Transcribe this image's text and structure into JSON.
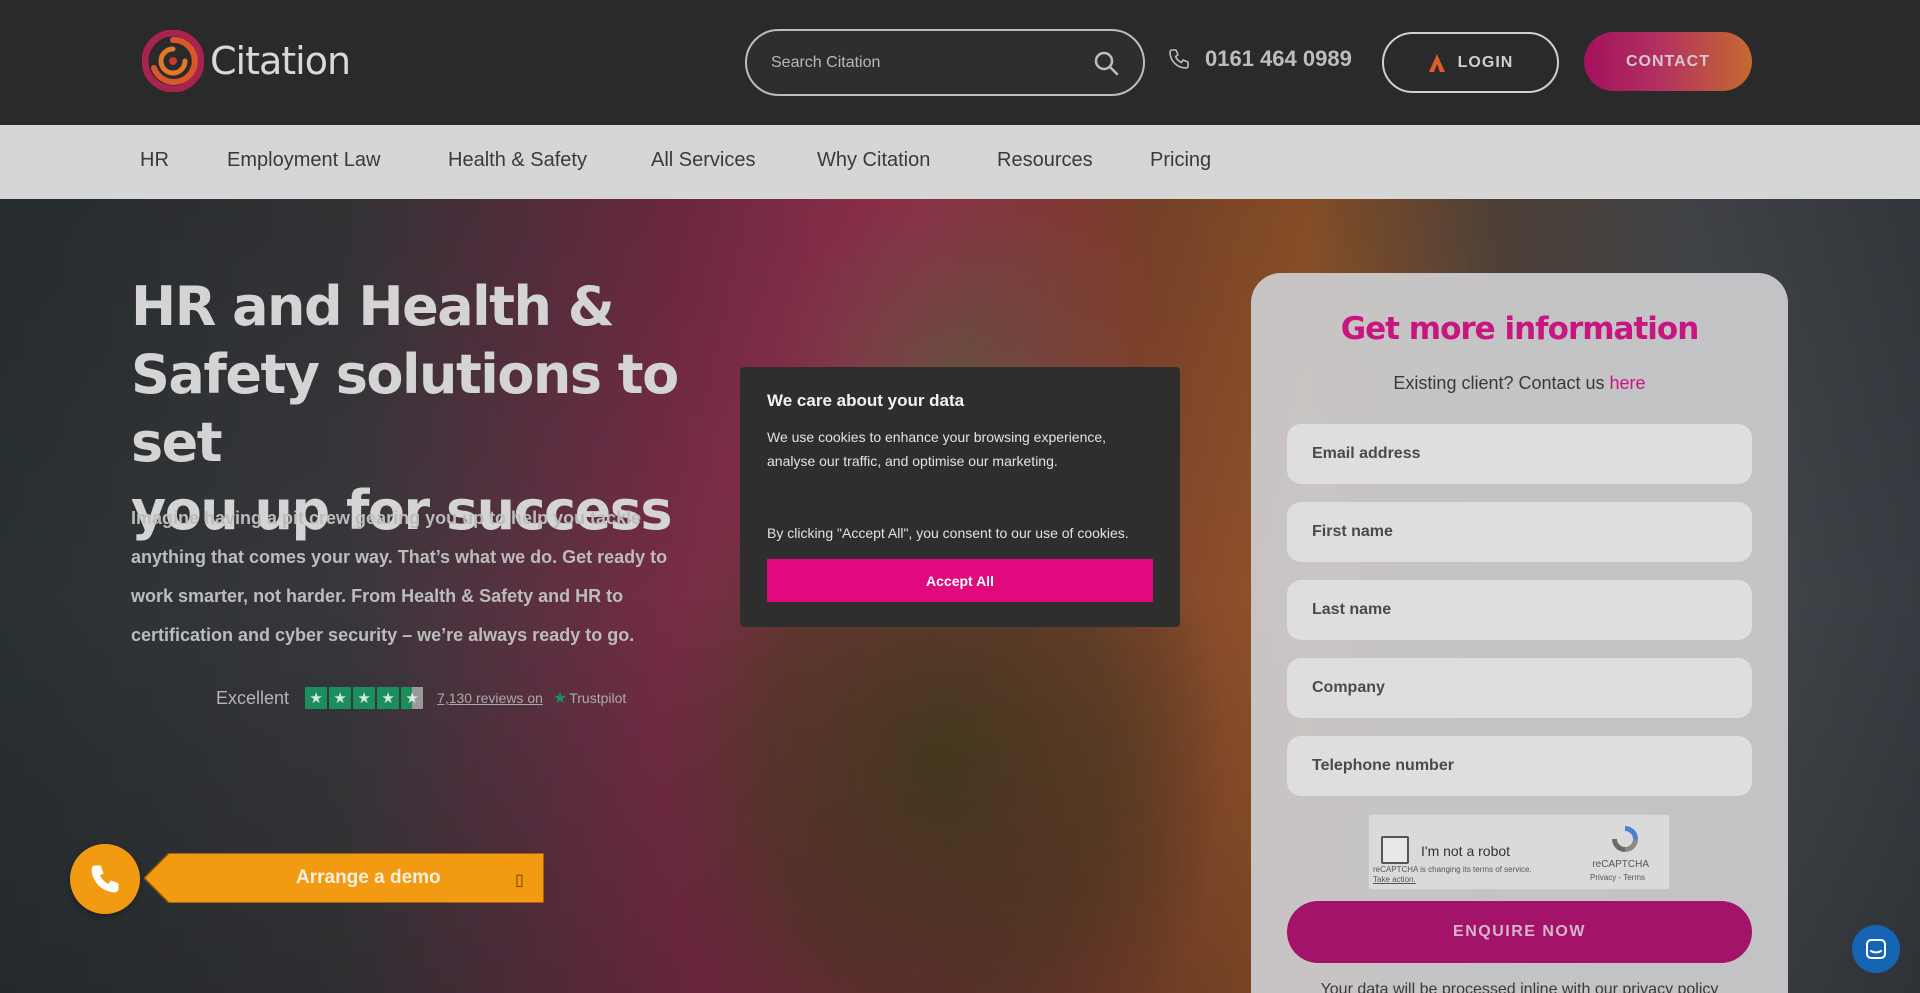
{
  "brand": {
    "name": "Citation"
  },
  "header": {
    "search_placeholder": "Search Citation",
    "phone": "0161 464 0989",
    "login_label": "LOGIN",
    "contact_label": "CONTACT"
  },
  "nav": {
    "items": [
      {
        "label": "HR"
      },
      {
        "label": "Employment Law"
      },
      {
        "label": "Health & Safety"
      },
      {
        "label": "All Services"
      },
      {
        "label": "Why Citation"
      },
      {
        "label": "Resources"
      },
      {
        "label": "Pricing"
      }
    ]
  },
  "hero": {
    "title_line1": "HR and Health &",
    "title_line2": "Safety solutions to set",
    "title_line3": "you up for success",
    "text": "Imagine having a pit crew gearing you up to help you tackle anything that comes your way. That’s what we do. Get ready to work smarter, not harder. From Health & Safety and HR to certification and cyber security – we’re always ready to go."
  },
  "trustpilot": {
    "rating_label": "Excellent",
    "reviews_link": "7,130 reviews on",
    "brand": "Trustpilot"
  },
  "demo": {
    "label": "Arrange a demo"
  },
  "cookie": {
    "title": "We care about your data",
    "body": "We use cookies to enhance your browsing experience, analyse our traffic, and optimise our marketing.",
    "consent": "By clicking \"Accept All\", you consent to our use of cookies.",
    "accept_label": "Accept All"
  },
  "form": {
    "title": "Get more information",
    "existing_prefix": "Existing client? Contact us ",
    "existing_link": "here",
    "fields": {
      "email": "Email address",
      "first_name": "First name",
      "last_name": "Last name",
      "company": "Company",
      "telephone": "Telephone number"
    },
    "recaptcha": {
      "label": "I'm not a robot",
      "brand": "reCAPTCHA",
      "terms": "Privacy - Terms",
      "note": "reCAPTCHA is changing its terms of service.",
      "note_link": "Take action."
    },
    "submit_label": "ENQUIRE NOW",
    "privacy_text": "Your data will be processed inline with our privacy policy"
  },
  "colors": {
    "accent_pink": "#e2087e",
    "brand_magenta": "#c8157f",
    "demo_orange": "#f29a12",
    "trustpilot_green": "#1a8f5c"
  }
}
